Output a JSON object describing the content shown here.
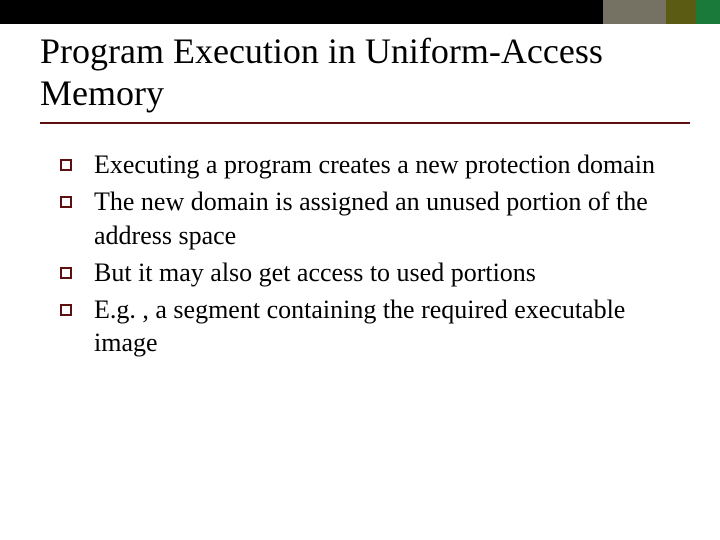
{
  "title": "Program Execution in Uniform-Access Memory",
  "bullets": [
    {
      "text": "Executing a program creates a new protection domain"
    },
    {
      "text": "The new domain is assigned an unused portion of the address space"
    },
    {
      "text": "But it may also get access to used portions"
    },
    {
      "text": "E.g. , a segment containing the required executable image"
    }
  ]
}
